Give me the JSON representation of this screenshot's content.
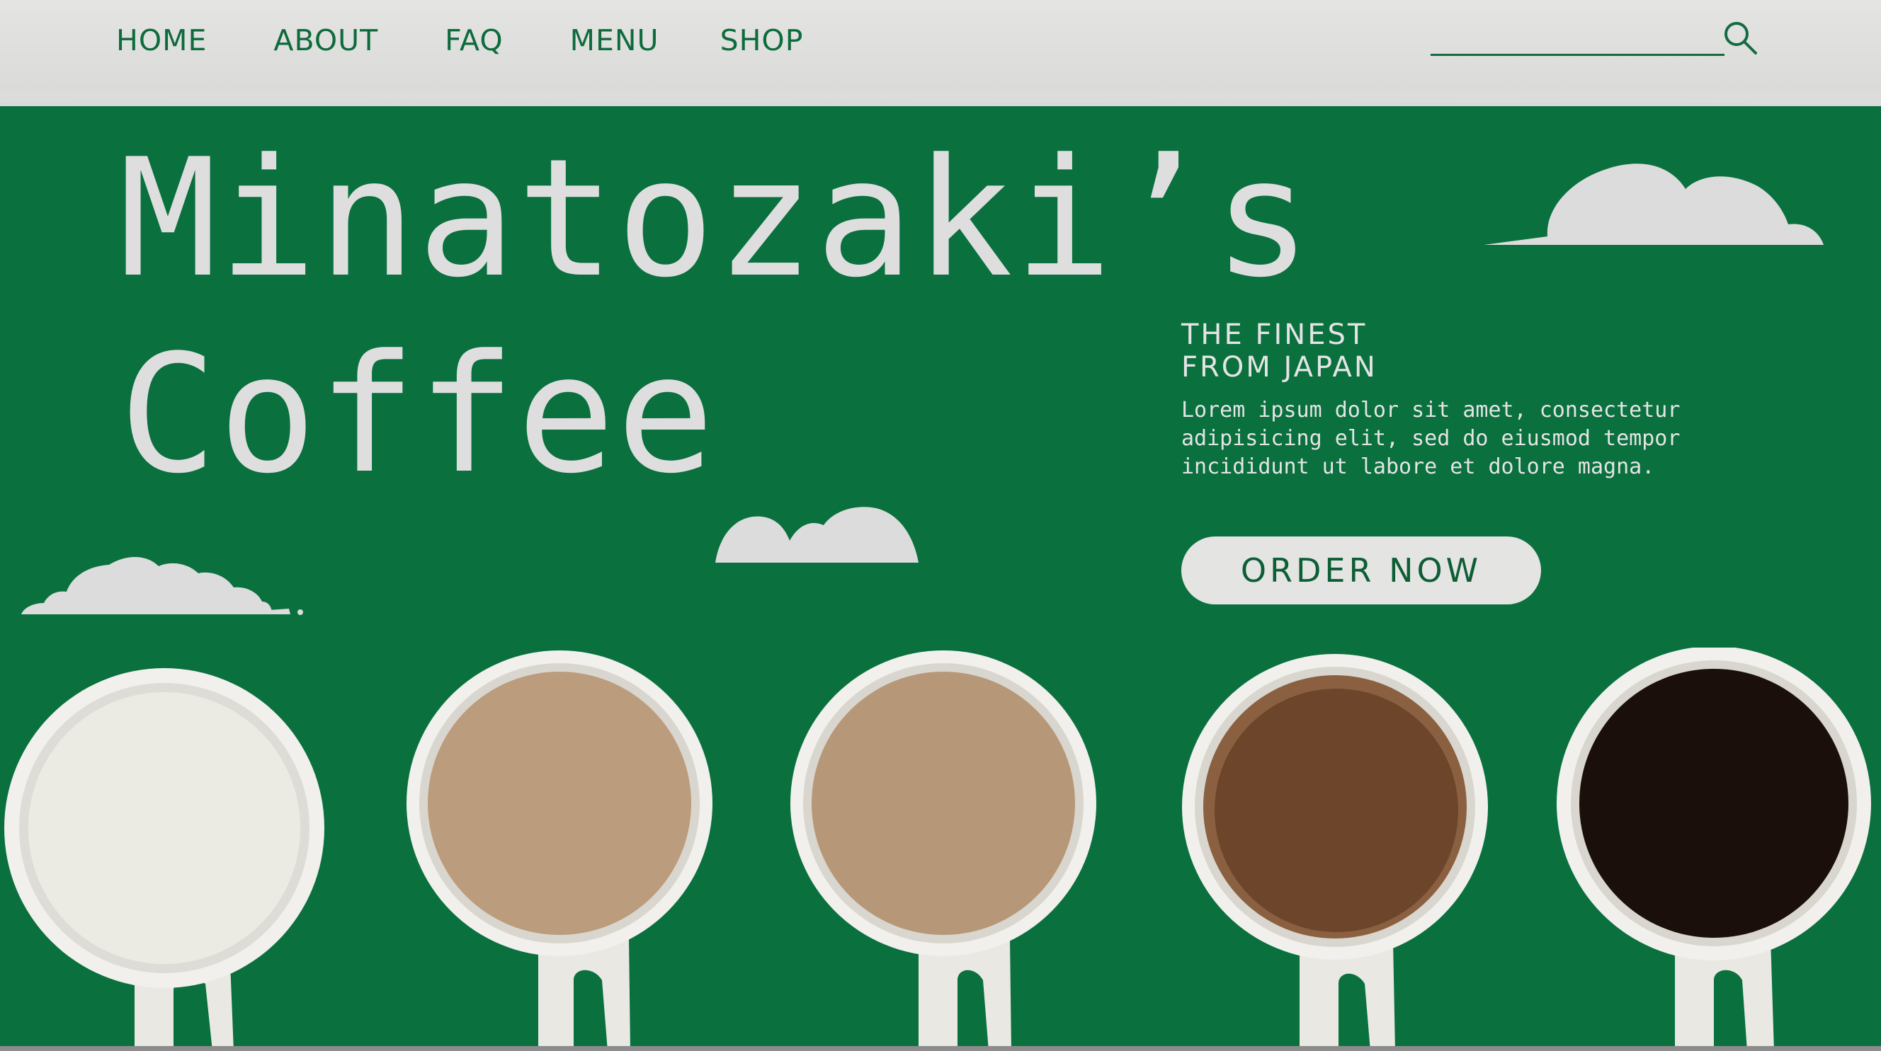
{
  "nav": {
    "items": [
      {
        "label": "HOME"
      },
      {
        "label": "ABOUT"
      },
      {
        "label": "FAQ"
      },
      {
        "label": "MENU"
      },
      {
        "label": "SHOP"
      }
    ]
  },
  "search": {
    "value": "",
    "placeholder": "",
    "icon": "search-icon"
  },
  "hero": {
    "title_line1": "Minatozaki’s",
    "title_line2": "Coffee",
    "tagline_line1": "THE FINEST",
    "tagline_line2": "FROM JAPAN",
    "body": "Lorem ipsum dolor sit amet, consectetur adipisicing elit, sed do eiusmod tempor incididunt ut labore et dolore magna.",
    "order_button": "ORDER NOW"
  },
  "decorations": {
    "clouds": 3,
    "cups": 5
  },
  "colors": {
    "background_green": "#09703e",
    "header_paper": "#e4e4e2",
    "nav_text": "#0d6b3c",
    "hero_text": "#dedede",
    "button_text": "#0d5e35",
    "cup_fills": [
      "#ecebe3",
      "#bb9c7c",
      "#b69878",
      "#6c452a",
      "#1a0f0b"
    ]
  }
}
